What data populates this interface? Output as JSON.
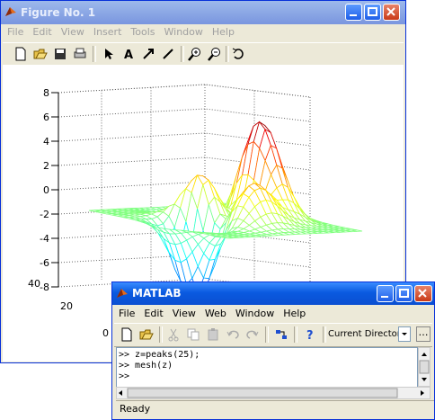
{
  "figure": {
    "title": "Figure No. 1",
    "menu": [
      "File",
      "Edit",
      "View",
      "Insert",
      "Tools",
      "Window",
      "Help"
    ],
    "tools": [
      "new-icon",
      "open-icon",
      "save-icon",
      "print-icon",
      "arrow-icon",
      "text-icon",
      "arrow-line-icon",
      "line-icon",
      "zoom-in-icon",
      "zoom-out-icon",
      "rotate-icon"
    ],
    "z_ticks": [
      "8",
      "6",
      "4",
      "2",
      "0",
      "-2",
      "-4",
      "-6",
      "-8"
    ],
    "x_ticks": [
      "40",
      "20",
      "0"
    ]
  },
  "chart_data": {
    "type": "surface-mesh",
    "function": "peaks(25)",
    "zlim": [
      -8,
      8
    ],
    "z_ticks": [
      8,
      6,
      4,
      2,
      0,
      -2,
      -4,
      -6,
      -8
    ],
    "grid": true,
    "colormap": "jet"
  },
  "matlab": {
    "title": "MATLAB",
    "menu": [
      "File",
      "Edit",
      "View",
      "Web",
      "Window",
      "Help"
    ],
    "current_dir_label": "Current Directory:",
    "command_lines": [
      ">> z=peaks(25);",
      ">> mesh(z)",
      ">> "
    ],
    "status": "Ready"
  },
  "colors": {
    "title_active": "#0a5ae0",
    "title_inactive": "#7a96df",
    "window_bg": "#ece9d8"
  }
}
